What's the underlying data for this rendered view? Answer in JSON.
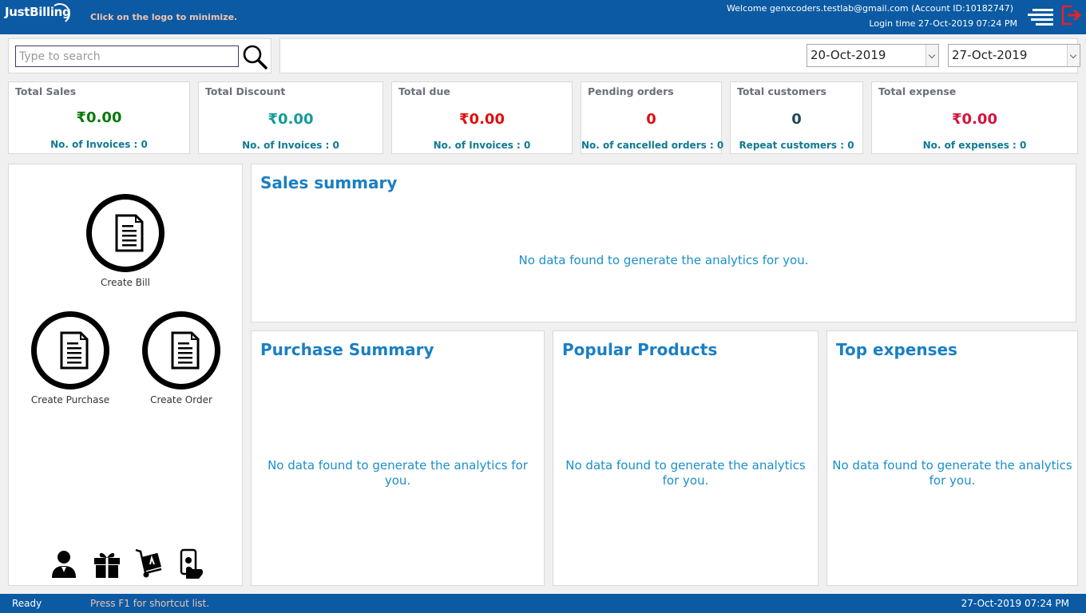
{
  "header": {
    "logo_text": "JustBilling",
    "hint": "Click on the logo to minimize.",
    "welcome": "Welcome genxcoders.testlab@gmail.com (Account ID:10182747)",
    "login_time": "Login time  27-Oct-2019 07:24 PM",
    "menu_icon": "hamburger-menu-icon",
    "logout_icon": "logout-icon",
    "colors": {
      "bar": "#0b5aa3",
      "hint": "#f3c4ae",
      "logout": "#e3242b"
    }
  },
  "search": {
    "placeholder": "Type to search",
    "value": "",
    "icon": "search-icon"
  },
  "date_range": {
    "from": "20-Oct-2019",
    "to": "27-Oct-2019"
  },
  "stats": [
    {
      "title": "Total Sales",
      "value": "₹0.00",
      "sub": "No. of Invoices : 0",
      "color": "#0a7a0a"
    },
    {
      "title": "Total Discount",
      "value": "₹0.00",
      "sub": "No. of Invoices : 0",
      "color": "#169a9a"
    },
    {
      "title": "Total due",
      "value": "₹0.00",
      "sub": "No. of Invoices : 0",
      "color": "#e01010"
    },
    {
      "title": "Pending orders",
      "value": "0",
      "sub": "No. of cancelled orders : 0",
      "color": "#e01010"
    },
    {
      "title": "Total customers",
      "value": "0",
      "sub": "Repeat customers :  0",
      "color": "#1e4a57"
    },
    {
      "title": "Total expense",
      "value": "₹0.00",
      "sub": "No. of expenses : 0",
      "color": "#d4143c"
    }
  ],
  "actions": {
    "create_bill": "Create Bill",
    "create_purchase": "Create Purchase",
    "create_order": "Create Order"
  },
  "bottom_icons": [
    "customer-icon",
    "gift-icon",
    "delivery-trolley-icon",
    "mobile-payment-icon"
  ],
  "panels": {
    "sales_summary": {
      "title": "Sales summary",
      "empty": "No data found to generate the analytics for you."
    },
    "purchase_summary": {
      "title": "Purchase Summary",
      "empty_line1": "No data found to generate the analytics for",
      "empty_line2": "you."
    },
    "popular_products": {
      "title": "Popular Products",
      "empty_line1": "No data found to generate the analytics",
      "empty_line2": "for you."
    },
    "top_expenses": {
      "title": "Top expenses",
      "empty_line1": "No data found to generate the analytics",
      "empty_line2": "for you."
    }
  },
  "status": {
    "ready": "Ready",
    "shortcut": "Press F1 for shortcut list.",
    "datetime": "27-Oct-2019 07:24 PM"
  }
}
